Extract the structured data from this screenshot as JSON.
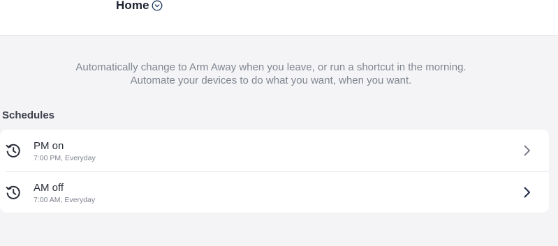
{
  "header": {
    "home_label": "Home"
  },
  "intro": {
    "line1": "Automatically change to Arm Away when you leave, or run a shortcut in the morning.",
    "line2": "Automate your devices to do what you want, when you want."
  },
  "schedules": {
    "title": "Schedules",
    "items": [
      {
        "name": "PM on",
        "detail": "7:00 PM, Everyday",
        "icon": "history-clock-icon"
      },
      {
        "name": "AM off",
        "detail": "7:00 AM, Everyday",
        "icon": "history-clock-icon"
      }
    ]
  },
  "colors": {
    "background": "#f4f4f6",
    "card": "#ffffff",
    "text_primary": "#1d2230",
    "text_secondary": "#7f8590",
    "accent_chevron": "#1f2a44"
  }
}
